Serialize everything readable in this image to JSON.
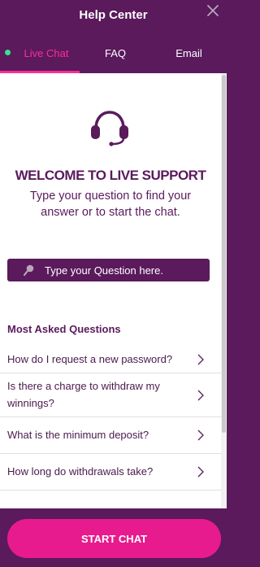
{
  "header": {
    "title": "Help Center",
    "close_icon": "close-icon"
  },
  "tabs": [
    {
      "label": "Live Chat",
      "active": true,
      "status_icon": "online-dot-icon"
    },
    {
      "label": "FAQ",
      "active": false
    },
    {
      "label": "Email",
      "active": false
    }
  ],
  "welcome": {
    "icon": "headset-icon",
    "title": "WELCOME TO LIVE SUPPORT",
    "subtitle": "Type your question to find your answer or to start the chat."
  },
  "search": {
    "placeholder": "Type your Question here.",
    "value": "",
    "icon": "search-icon"
  },
  "faq": {
    "title": "Most Asked Questions",
    "items": [
      {
        "question": "How do I request a new password?"
      },
      {
        "question": "Is there a charge to withdraw my winnings?"
      },
      {
        "question": "What is the minimum deposit?"
      },
      {
        "question": "How long do withdrawals take?"
      }
    ]
  },
  "footer": {
    "start_chat_label": "START CHAT"
  },
  "colors": {
    "brand_purple": "#5a1a5c",
    "accent_pink": "#e71b8d",
    "active_tab": "#ff2d95",
    "online": "#38e38b"
  }
}
